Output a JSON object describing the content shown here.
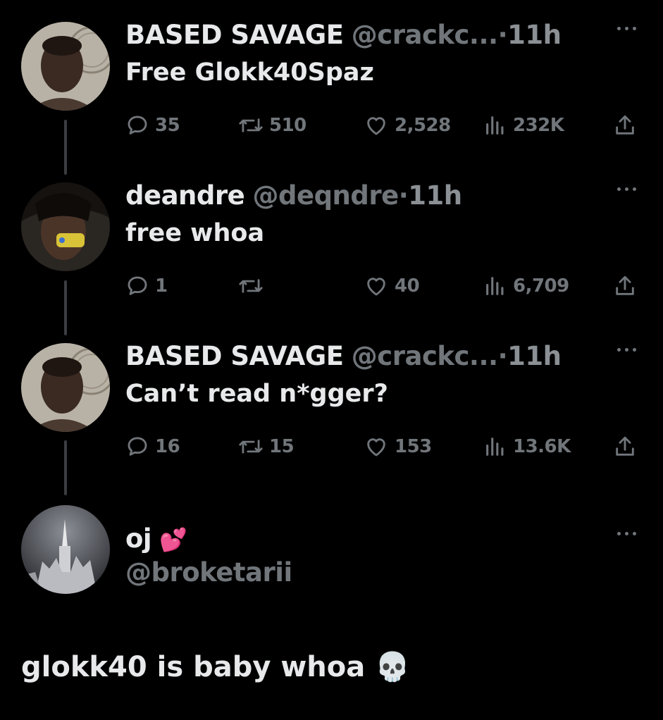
{
  "tweets": [
    {
      "name": "BASED SAVAGE",
      "handle": "@crackc...",
      "dot": "·",
      "time": "11h",
      "text": "Free Glokk40Spaz",
      "replies": "35",
      "reposts": "510",
      "likes": "2,528",
      "views": "232K"
    },
    {
      "name": "deandre",
      "handle": "@deqndre",
      "dot": "·",
      "time": "11h",
      "text": "free whoa",
      "replies": "1",
      "reposts": "",
      "likes": "40",
      "views": "6,709"
    },
    {
      "name": "BASED SAVAGE",
      "handle": "@crackc...",
      "dot": "·",
      "time": "11h",
      "text": "Can’t read n*gger?",
      "replies": "16",
      "reposts": "15",
      "likes": "153",
      "views": "13.6K"
    }
  ],
  "reply_author": {
    "name": "oj",
    "emoji": "💕",
    "handle": "@broketarii"
  },
  "reply_text": "glokk40 is baby whoa",
  "reply_emoji": "💀",
  "icons": {
    "reply": "speech-bubble-icon",
    "repost": "repost-arrows-icon",
    "like": "heart-icon",
    "views": "bar-chart-icon",
    "share": "share-upload-icon",
    "more": "ellipsis-icon"
  },
  "colors": {
    "background": "#000000",
    "primary_text": "#e7e9ea",
    "secondary_text": "#71767b",
    "thread_line": "#3a3d41"
  }
}
